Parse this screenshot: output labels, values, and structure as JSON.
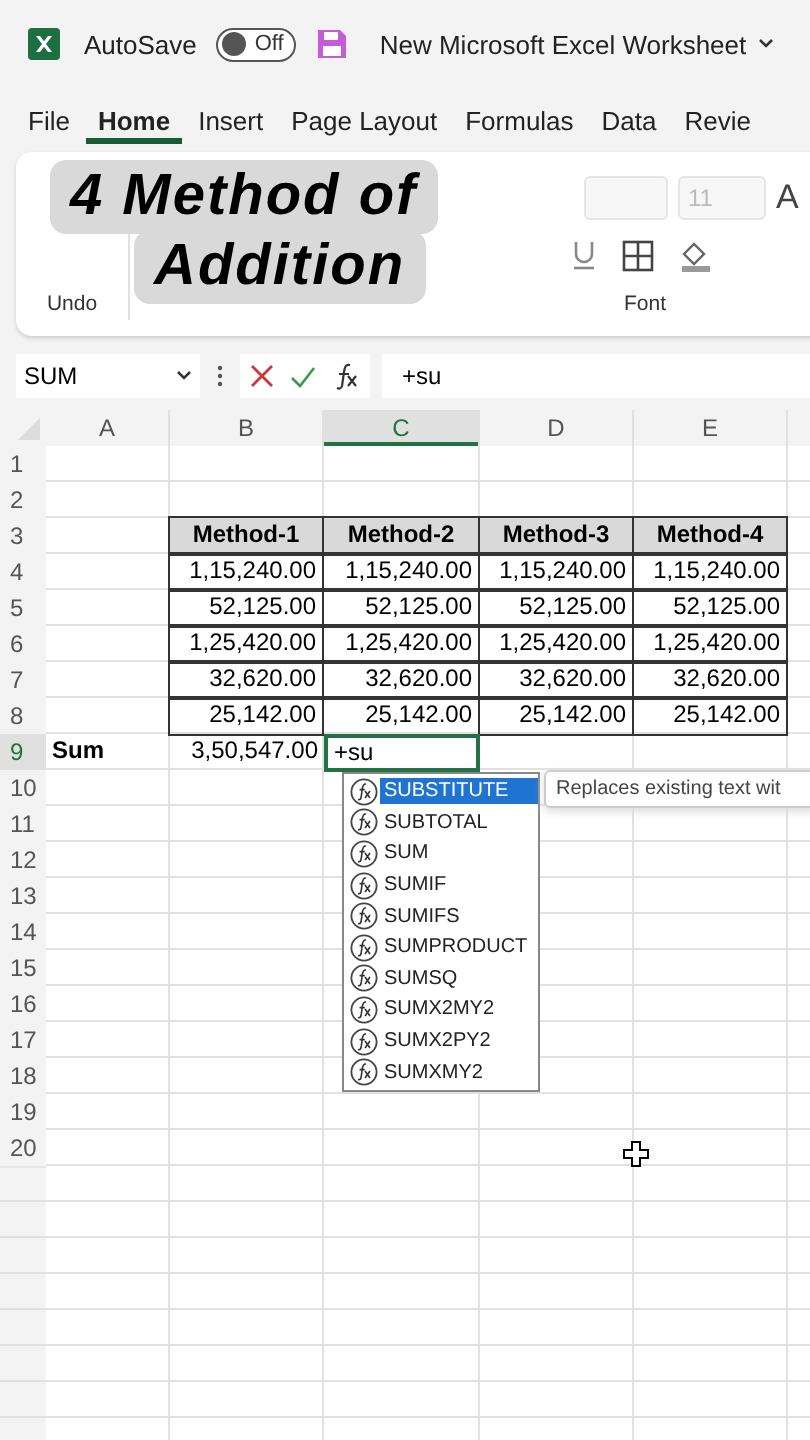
{
  "titlebar": {
    "autosave": {
      "label": "AutoSave",
      "on": false,
      "state_text": "Off"
    },
    "title": "New Microsoft Excel Worksheet"
  },
  "tabs": [
    {
      "label": "File",
      "selected": false
    },
    {
      "label": "Home",
      "selected": true
    },
    {
      "label": "Insert",
      "selected": false
    },
    {
      "label": "Page Layout",
      "selected": false
    },
    {
      "label": "Formulas",
      "selected": false
    },
    {
      "label": "Data",
      "selected": false
    },
    {
      "label": "Revie",
      "selected": false
    }
  ],
  "ribbon": {
    "font_size": "11",
    "grow_font": "A",
    "groups": [
      "Undo",
      "Font"
    ]
  },
  "overlay": {
    "lines": [
      "4 Method of",
      "Addition"
    ]
  },
  "formula_bar": {
    "name_box": "SUM",
    "formula": "+su"
  },
  "columns": [
    {
      "label": "A",
      "selected": false
    },
    {
      "label": "B",
      "selected": false
    },
    {
      "label": "C",
      "selected": true
    },
    {
      "label": "D",
      "selected": false
    },
    {
      "label": "E",
      "selected": false
    }
  ],
  "rows": [
    {
      "label": "1",
      "kind": "blank",
      "selected": false,
      "cells": [
        "",
        "",
        "",
        "",
        ""
      ]
    },
    {
      "label": "2",
      "kind": "blank",
      "selected": false,
      "cells": [
        "",
        "",
        "",
        "",
        ""
      ]
    },
    {
      "label": "3",
      "kind": "header",
      "selected": false,
      "cells": [
        "",
        "Method-1",
        "Method-2",
        "Method-3",
        "Method-4"
      ]
    },
    {
      "label": "4",
      "kind": "data",
      "selected": false,
      "cells": [
        "",
        "1,15,240.00",
        "1,15,240.00",
        "1,15,240.00",
        "1,15,240.00"
      ]
    },
    {
      "label": "5",
      "kind": "data",
      "selected": false,
      "cells": [
        "",
        "52,125.00",
        "52,125.00",
        "52,125.00",
        "52,125.00"
      ]
    },
    {
      "label": "6",
      "kind": "data",
      "selected": false,
      "cells": [
        "",
        "1,25,420.00",
        "1,25,420.00",
        "1,25,420.00",
        "1,25,420.00"
      ]
    },
    {
      "label": "7",
      "kind": "data",
      "selected": false,
      "cells": [
        "",
        "32,620.00",
        "32,620.00",
        "32,620.00",
        "32,620.00"
      ]
    },
    {
      "label": "8",
      "kind": "data",
      "selected": false,
      "cells": [
        "",
        "25,142.00",
        "25,142.00",
        "25,142.00",
        "25,142.00"
      ]
    },
    {
      "label": "9",
      "kind": "sum",
      "selected": true,
      "cells": [
        "Sum",
        "3,50,547.00",
        "+su",
        "",
        ""
      ]
    },
    {
      "label": "10",
      "kind": "blank",
      "selected": false,
      "cells": [
        "",
        "",
        "",
        "",
        ""
      ]
    },
    {
      "label": "11",
      "kind": "blank",
      "selected": false,
      "cells": [
        "",
        "",
        "",
        "",
        ""
      ]
    },
    {
      "label": "12",
      "kind": "blank",
      "selected": false,
      "cells": [
        "",
        "",
        "",
        "",
        ""
      ]
    },
    {
      "label": "13",
      "kind": "blank",
      "selected": false,
      "cells": [
        "",
        "",
        "",
        "",
        ""
      ]
    },
    {
      "label": "14",
      "kind": "blank",
      "selected": false,
      "cells": [
        "",
        "",
        "",
        "",
        ""
      ]
    },
    {
      "label": "15",
      "kind": "blank",
      "selected": false,
      "cells": [
        "",
        "",
        "",
        "",
        ""
      ]
    },
    {
      "label": "16",
      "kind": "blank",
      "selected": false,
      "cells": [
        "",
        "",
        "",
        "",
        ""
      ]
    },
    {
      "label": "17",
      "kind": "blank",
      "selected": false,
      "cells": [
        "",
        "",
        "",
        "",
        ""
      ]
    },
    {
      "label": "18",
      "kind": "blank",
      "selected": false,
      "cells": [
        "",
        "",
        "",
        "",
        ""
      ]
    },
    {
      "label": "19",
      "kind": "blank",
      "selected": false,
      "cells": [
        "",
        "",
        "",
        "",
        ""
      ]
    },
    {
      "label": "20",
      "kind": "blank",
      "selected": false,
      "cells": [
        "",
        "",
        "",
        "",
        ""
      ]
    }
  ],
  "autocomplete": {
    "items": [
      {
        "label": "SUBSTITUTE",
        "selected": true
      },
      {
        "label": "SUBTOTAL",
        "selected": false
      },
      {
        "label": "SUM",
        "selected": false
      },
      {
        "label": "SUMIF",
        "selected": false
      },
      {
        "label": "SUMIFS",
        "selected": false
      },
      {
        "label": "SUMPRODUCT",
        "selected": false
      },
      {
        "label": "SUMSQ",
        "selected": false
      },
      {
        "label": "SUMX2MY2",
        "selected": false
      },
      {
        "label": "SUMX2PY2",
        "selected": false
      },
      {
        "label": "SUMXMY2",
        "selected": false
      }
    ],
    "tooltip": "Replaces existing text wit"
  }
}
